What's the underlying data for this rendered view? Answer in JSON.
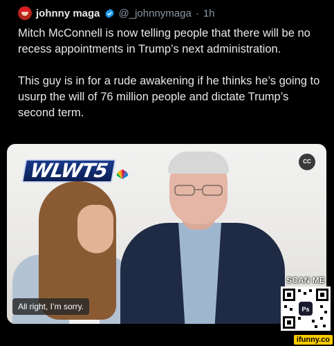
{
  "tweet": {
    "display_name": "johnny maga",
    "handle": "@_johnnymaga",
    "separator": "·",
    "time": "1h",
    "paragraphs": [
      "Mitch McConnell is now telling people that there will be no recess appointments in Trump’s next administration.",
      "This guy is in for a rude awakening if he thinks he’s going to usurp the will of 76 million people and dictate Trump’s second term."
    ]
  },
  "media": {
    "station_logo": "WLWT5",
    "cc_label": "CC",
    "caption": "All right, I’m sorry."
  },
  "overlay": {
    "scan_label": "SCAN ME",
    "watermark": "ifunny.co"
  },
  "colors": {
    "background": "#000000",
    "text": "#e7e9ea",
    "muted": "#8b98a5",
    "verified": "#1d9bf0",
    "watermark_bg": "#ffcc00"
  }
}
